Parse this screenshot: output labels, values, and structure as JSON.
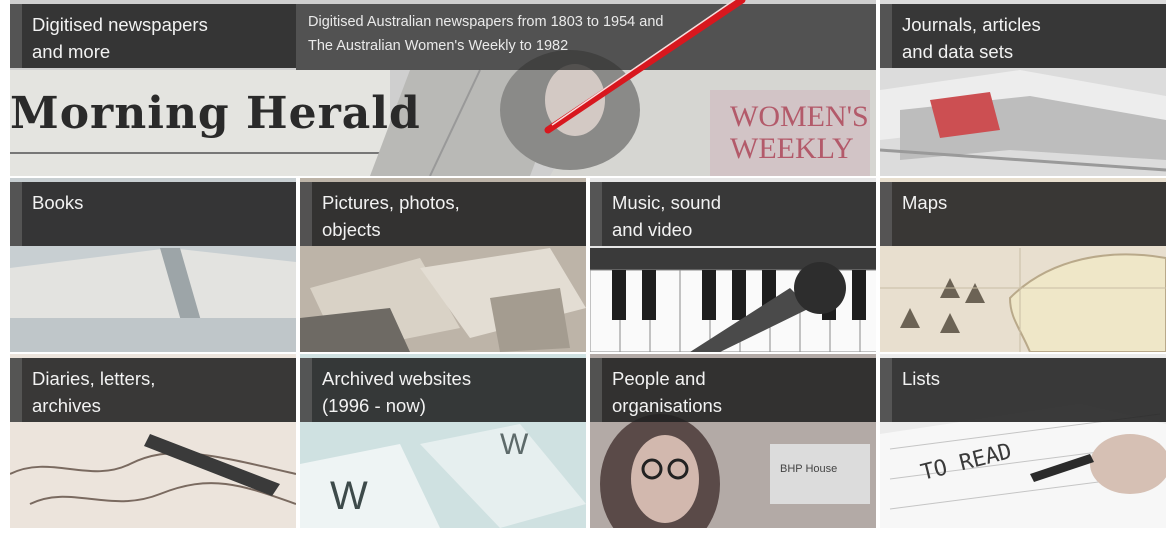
{
  "tiles": {
    "newspapers": {
      "label": "Digitised newspapers\nand more",
      "description": "Digitised Australian newspapers from 1803 to 1954 and\nThe Australian Women's Weekly to 1982",
      "masthead_1": "Morning Herald",
      "masthead_2": "WOMEN'S",
      "masthead_3": "WEEKLY"
    },
    "journals": {
      "label": "Journals, articles\nand data sets"
    },
    "books": {
      "label": "Books"
    },
    "pictures": {
      "label": "Pictures, photos,\nobjects"
    },
    "music": {
      "label": "Music, sound\nand video"
    },
    "maps": {
      "label": "Maps"
    },
    "diaries": {
      "label": "Diaries, letters,\narchives"
    },
    "websites": {
      "label": "Archived websites\n(1996 - now)"
    },
    "people": {
      "label": "People and\norganisations"
    },
    "lists": {
      "label": "Lists",
      "note": "TO READ"
    }
  },
  "colors": {
    "label_bg": "#202020",
    "arrow": "#d8171e"
  }
}
